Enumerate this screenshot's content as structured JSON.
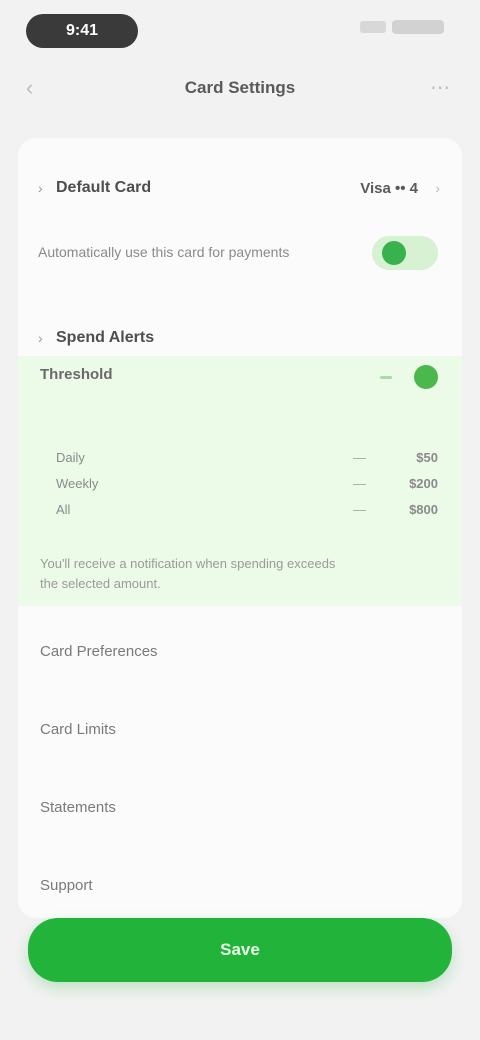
{
  "status_bar": {
    "time": "9:41"
  },
  "nav": {
    "back": "‹",
    "title": "Card Settings",
    "action": "⋯"
  },
  "section_one": {
    "chevron": "›",
    "title": "Default Card",
    "value": "Visa •• 4",
    "arrow": "›"
  },
  "toggle_row": {
    "label": "Automatically use this card for payments",
    "enabled": true
  },
  "section_two": {
    "chevron": "›",
    "title": "Spend Alerts"
  },
  "alerts": {
    "title": "Threshold",
    "rows": [
      {
        "key": "Daily",
        "left": "—",
        "value": "$50"
      },
      {
        "key": "Weekly",
        "left": "—",
        "value": "$200"
      },
      {
        "key": "All",
        "left": "—",
        "value": "$800"
      }
    ],
    "note": "You'll receive a notification when spending exceeds the selected amount."
  },
  "list": [
    {
      "label": "Card Preferences"
    },
    {
      "label": "Card Limits"
    },
    {
      "label": "Statements"
    },
    {
      "label": "Support"
    }
  ],
  "primary_button": {
    "label": "Save"
  },
  "colors": {
    "accent": "#22b33a",
    "tint": "#ecfbe8",
    "background": "#f2f2f2"
  }
}
